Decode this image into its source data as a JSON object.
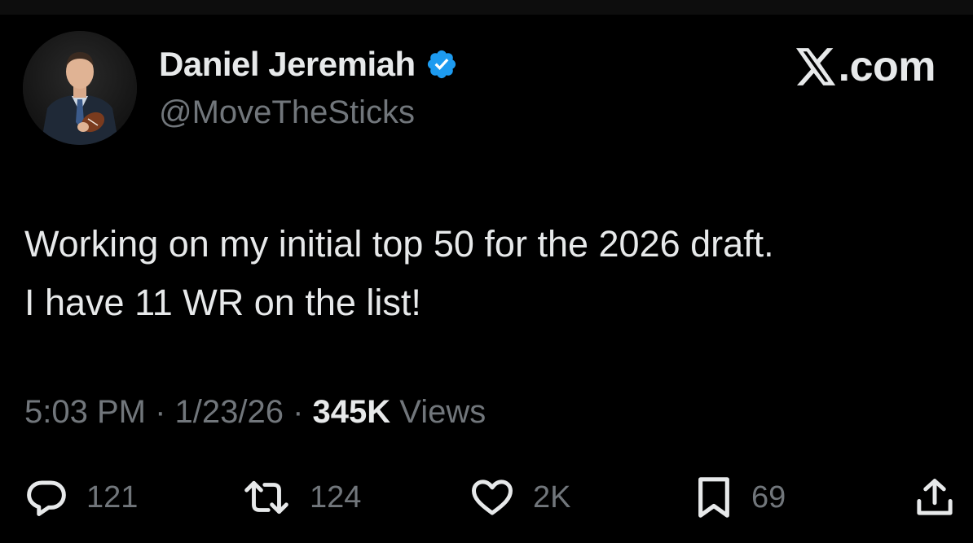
{
  "author": {
    "display_name": "Daniel Jeremiah",
    "handle": "@MoveTheSticks",
    "verified": true,
    "verified_color": "#1d9bf0"
  },
  "brand": {
    "logo_icon": "x-logo-icon",
    "text": ".com"
  },
  "tweet": {
    "text_line1": "Working on my initial top 50 for the 2026 draft.",
    "text_line2": "I have 11 WR on the list!"
  },
  "meta": {
    "time": "5:03 PM",
    "separator1": " · ",
    "date": "1/23/26",
    "separator2": " · ",
    "views_count": "345K",
    "views_label": " Views"
  },
  "actions": {
    "replies": {
      "icon": "reply-icon",
      "count": "121"
    },
    "reposts": {
      "icon": "repost-icon",
      "count": "124"
    },
    "likes": {
      "icon": "heart-icon",
      "count": "2K"
    },
    "bookmarks": {
      "icon": "bookmark-icon",
      "count": "69"
    },
    "share": {
      "icon": "share-icon"
    }
  },
  "colors": {
    "background": "#000000",
    "primary_text": "#e7e9ea",
    "secondary_text": "#71767b",
    "verified_blue": "#1d9bf0"
  }
}
